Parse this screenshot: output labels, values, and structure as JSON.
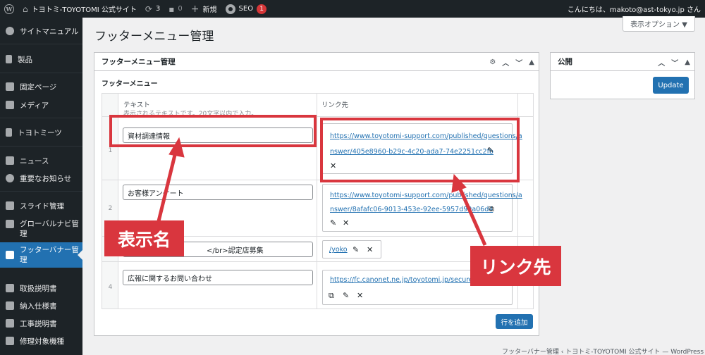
{
  "adminbar": {
    "site_name": "トヨトミ-TOYOTOMI 公式サイト",
    "updates_count": "3",
    "comments_count": "0",
    "new_label": "新規",
    "seo_label": "SEO",
    "seo_badge": "1",
    "greeting": "こんにちは、makoto@ast-tokyo.jp さん"
  },
  "sidebar": {
    "items": [
      {
        "label": "サイトマニュアル"
      },
      {
        "label": "製品"
      },
      {
        "label": "固定ページ"
      },
      {
        "label": "メディア"
      },
      {
        "label": "トヨトミーツ"
      },
      {
        "label": "ニュース"
      },
      {
        "label": "重要なお知らせ"
      },
      {
        "label": "スライド管理"
      },
      {
        "label": "グローバルナビ管理"
      },
      {
        "label": "フッターバナー管理"
      },
      {
        "label": "取扱説明書"
      },
      {
        "label": "納入仕様書"
      },
      {
        "label": "工事説明書"
      },
      {
        "label": "修理対象機種"
      }
    ]
  },
  "screen_options": "表示オプション ▼",
  "page_title": "フッターメニュー管理",
  "metabox": {
    "title": "フッターメニュー管理",
    "section_label": "フッターメニュー",
    "col_text": "テキスト",
    "col_text_desc": "表示されるテキストです。20文字以内で入力。",
    "col_link": "リンク先",
    "rows": [
      {
        "num": "1",
        "text": "資材調達情報",
        "url_line1": "https://www.toyotomi-support.com/published/questions/a",
        "url_line2": "nswer/405e8960-b29c-4c20-ada7-74e2251cc2fb"
      },
      {
        "num": "2",
        "text": "お客様アンケート",
        "url_line1": "https://www.toyotomi-support.com/published/questions/a",
        "url_line2": "nswer/8afafc06-9013-453e-92ee-5957d99a06d4"
      },
      {
        "num": "",
        "text": "</br>認定店募集",
        "url_line1": "/yoko",
        "url_line2": ""
      },
      {
        "num": "4",
        "text": "広報に関するお問い合わせ",
        "url_line1": "https://fc.canonet.ne.jp/toyotomi.jp/secure/f",
        "url_line2": ""
      }
    ],
    "add_row_label": "行を追加"
  },
  "publish": {
    "title": "公開",
    "update_label": "Update"
  },
  "footer": "フッターバナー管理 ‹ トヨトミ-TOYOTOMI 公式サイト — WordPress",
  "annotations": {
    "label_name": "表示名",
    "label_link": "リンク先",
    "accent_color": "#d9363e"
  },
  "colors": {
    "adminbar_bg": "#1d2327",
    "primary_blue": "#2271b1",
    "page_bg": "#f0f0f1"
  }
}
